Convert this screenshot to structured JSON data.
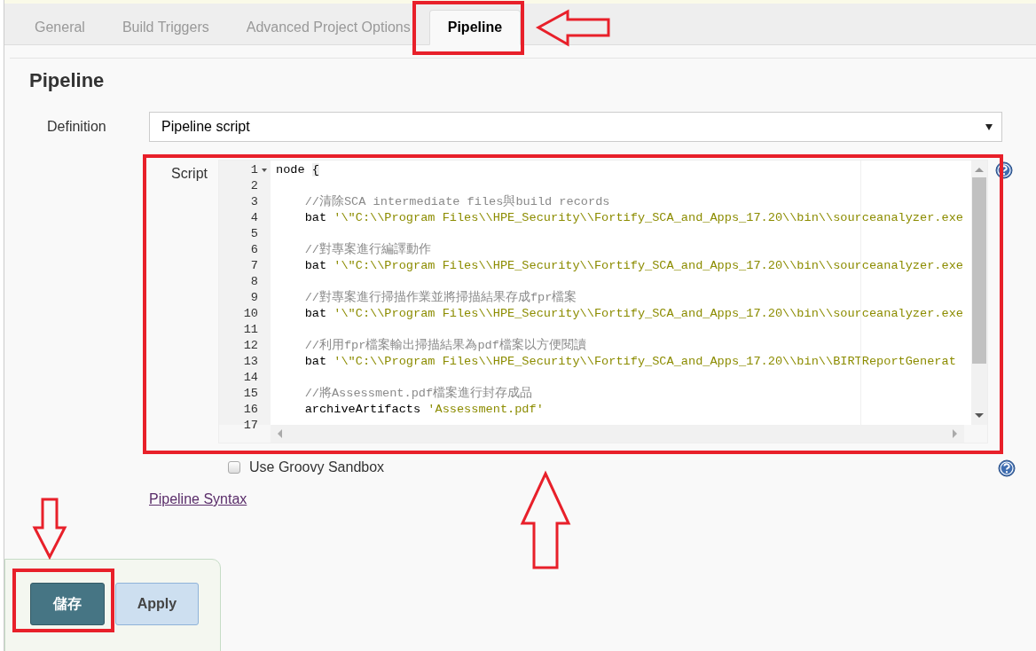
{
  "tabs": [
    {
      "label": "General",
      "selected": false
    },
    {
      "label": "Build Triggers",
      "selected": false
    },
    {
      "label": "Advanced Project Options",
      "selected": false
    },
    {
      "label": "Pipeline",
      "selected": true
    }
  ],
  "section": {
    "title": "Pipeline"
  },
  "definition": {
    "label": "Definition",
    "value": "Pipeline script"
  },
  "script": {
    "label": "Script",
    "lines": [
      {
        "number": "1",
        "foldable": true,
        "parts": [
          {
            "kind": "plain",
            "text": "node "
          },
          {
            "kind": "bracket",
            "text": "{"
          }
        ]
      },
      {
        "number": "2",
        "foldable": false
      },
      {
        "number": "3",
        "foldable": false,
        "parts": [
          {
            "kind": "comment",
            "text": "    //清除SCA intermediate files與build records"
          }
        ]
      },
      {
        "number": "4",
        "foldable": false,
        "parts": [
          {
            "kind": "plain",
            "text": "    bat "
          },
          {
            "kind": "string",
            "text": "'\\\"C:\\\\Program Files\\\\HPE_Security\\\\Fortify_SCA_and_Apps_17.20\\\\bin\\\\sourceanalyzer.exe"
          }
        ]
      },
      {
        "number": "5",
        "foldable": false
      },
      {
        "number": "6",
        "foldable": false,
        "parts": [
          {
            "kind": "comment",
            "text": "    //對專案進行編譯動作"
          }
        ]
      },
      {
        "number": "7",
        "foldable": false,
        "parts": [
          {
            "kind": "plain",
            "text": "    bat "
          },
          {
            "kind": "string",
            "text": "'\\\"C:\\\\Program Files\\\\HPE_Security\\\\Fortify_SCA_and_Apps_17.20\\\\bin\\\\sourceanalyzer.exe"
          }
        ]
      },
      {
        "number": "8",
        "foldable": false
      },
      {
        "number": "9",
        "foldable": false,
        "parts": [
          {
            "kind": "comment",
            "text": "    //對專案進行掃描作業並將掃描結果存成fpr檔案"
          }
        ]
      },
      {
        "number": "10",
        "foldable": false,
        "parts": [
          {
            "kind": "plain",
            "text": "    bat "
          },
          {
            "kind": "string",
            "text": "'\\\"C:\\\\Program Files\\\\HPE_Security\\\\Fortify_SCA_and_Apps_17.20\\\\bin\\\\sourceanalyzer.exe"
          }
        ]
      },
      {
        "number": "11",
        "foldable": false
      },
      {
        "number": "12",
        "foldable": false,
        "parts": [
          {
            "kind": "comment",
            "text": "    //利用fpr檔案輸出掃描結果為pdf檔案以方便閱讀"
          }
        ]
      },
      {
        "number": "13",
        "foldable": false,
        "parts": [
          {
            "kind": "plain",
            "text": "    bat "
          },
          {
            "kind": "string",
            "text": "'\\\"C:\\\\Program Files\\\\HPE_Security\\\\Fortify_SCA_and_Apps_17.20\\\\bin\\\\BIRTReportGenerat"
          }
        ]
      },
      {
        "number": "14",
        "foldable": false
      },
      {
        "number": "15",
        "foldable": false,
        "parts": [
          {
            "kind": "comment",
            "text": "    //將Assessment.pdf檔案進行封存成品"
          }
        ]
      },
      {
        "number": "16",
        "foldable": false,
        "parts": [
          {
            "kind": "plain",
            "text": "    archiveArtifacts "
          },
          {
            "kind": "string",
            "text": "'Assessment.pdf'"
          }
        ]
      },
      {
        "number": "17",
        "foldable": false
      }
    ]
  },
  "sandbox": {
    "label": "Use Groovy Sandbox",
    "checked": false
  },
  "syntax_link": "Pipeline Syntax",
  "buttons": [
    {
      "label": "儲存",
      "kind": "primary"
    },
    {
      "label": "Apply",
      "kind": "secondary"
    }
  ]
}
